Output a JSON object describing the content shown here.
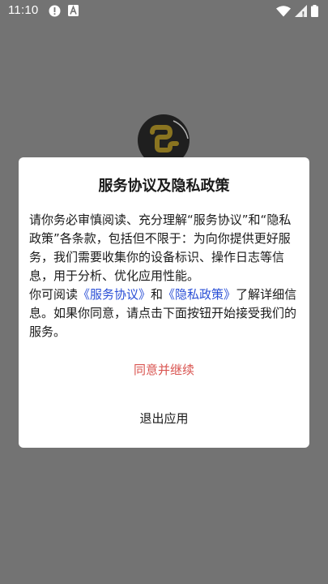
{
  "status_bar": {
    "time": "11:10",
    "icons": [
      "alert-circle-icon",
      "a-badge-icon",
      "wifi-icon",
      "signal-icon",
      "battery-icon"
    ]
  },
  "app": {
    "logo_icon": "app-logo-icon",
    "logo_colors": {
      "background": "#1f1f1f",
      "symbol": "#8a7420"
    }
  },
  "dialog": {
    "title": "服务协议及隐私政策",
    "paragraph1": "请你务必审慎阅读、充分理解“服务协议”和“隐私政策”各条款，包括但不限于：为向你提供更好服务，我们需要收集你的设备标识、操作日志等信息，用于分析、优化应用性能。",
    "paragraph2_prefix": "你可阅读",
    "service_agreement_link": "《服务协议》",
    "paragraph2_and": "和",
    "privacy_policy_link": "《隐私政策》",
    "paragraph2_suffix": "了解详细信息。如果你同意，请点击下面按钮开始接受我们的服务。",
    "agree_button": "同意并继续",
    "exit_button": "退出应用"
  },
  "colors": {
    "overlay": "#737373",
    "agree_text": "#d9534f",
    "link": "#2a4fd6"
  }
}
